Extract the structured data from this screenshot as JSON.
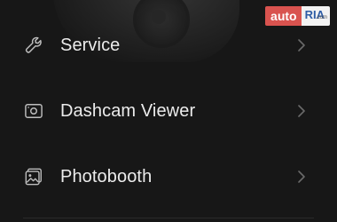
{
  "watermark": {
    "brand_left": "auto",
    "brand_right": "RIA",
    "brand_sub": ".com"
  },
  "menu": {
    "items": [
      {
        "label": "Service",
        "icon": "wrench-icon"
      },
      {
        "label": "Dashcam Viewer",
        "icon": "dashcam-icon"
      },
      {
        "label": "Photobooth",
        "icon": "photobooth-icon"
      }
    ]
  },
  "colors": {
    "background": "#171717",
    "text": "#ececec",
    "icon": "#bdbdbd",
    "chevron": "#6a6a6a",
    "watermark_red": "#d9534f",
    "watermark_blue": "#2d5ca6"
  }
}
